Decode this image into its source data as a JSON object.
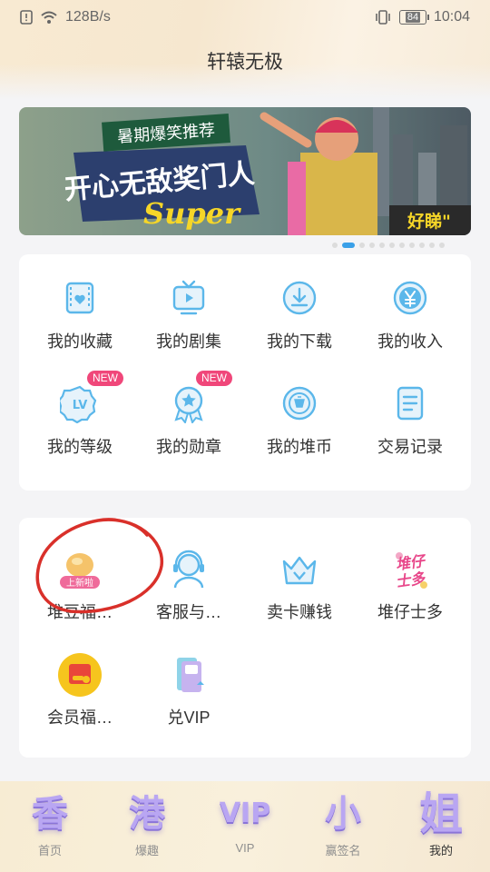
{
  "status": {
    "network_speed": "128B/s",
    "battery": "84",
    "time": "10:04"
  },
  "app": {
    "title": "轩辕无极"
  },
  "banner": {
    "tag": "暑期爆笑推荐",
    "headline": "开心无敌奖门人",
    "script_text": "Super",
    "corner_tag": "好睇\"",
    "pages": 11,
    "active_page": 2
  },
  "menu1": [
    {
      "label": "我的收藏",
      "icon": "film-heart-icon"
    },
    {
      "label": "我的剧集",
      "icon": "tv-play-icon"
    },
    {
      "label": "我的下载",
      "icon": "download-icon"
    },
    {
      "label": "我的收入",
      "icon": "yen-coin-icon"
    },
    {
      "label": "我的等级",
      "icon": "level-badge-icon",
      "badge": "NEW"
    },
    {
      "label": "我的勋章",
      "icon": "medal-icon",
      "badge": "NEW"
    },
    {
      "label": "我的堆币",
      "icon": "coin-icon"
    },
    {
      "label": "交易记录",
      "icon": "record-list-icon"
    }
  ],
  "menu2": [
    {
      "label": "堆豆福…",
      "icon": "bean-bowl-icon",
      "badge": "上新啦"
    },
    {
      "label": "客服与…",
      "icon": "customer-service-icon"
    },
    {
      "label": "卖卡赚钱",
      "icon": "crown-icon"
    },
    {
      "label": "堆仔士多",
      "icon": "shop-logo-icon",
      "logo_text": "堆仔士多"
    },
    {
      "label": "会员福…",
      "icon": "member-gift-icon"
    },
    {
      "label": "兑VIP",
      "icon": "vip-card-icon"
    }
  ],
  "nav": [
    {
      "label": "首页",
      "glyph": "香"
    },
    {
      "label": "爆趣",
      "glyph": "港"
    },
    {
      "label": "VIP",
      "glyph": "VIP"
    },
    {
      "label": "赢签名",
      "glyph": "小"
    },
    {
      "label": "我的",
      "glyph": "姐"
    }
  ],
  "colors": {
    "accent": "#3aa0e8",
    "icon_blue": "#5bb7ea",
    "new_badge": "#f0477a",
    "annotation_red": "#d9302a"
  }
}
